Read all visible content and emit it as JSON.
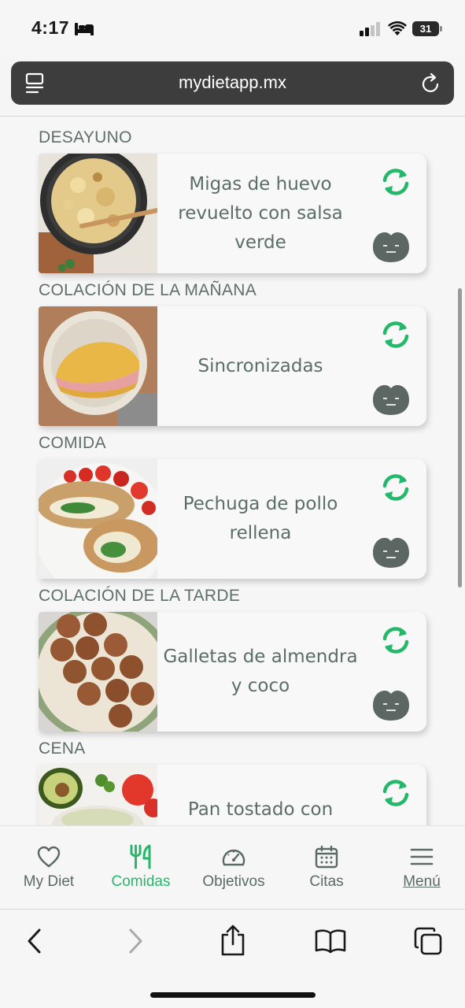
{
  "status": {
    "time": "4:17",
    "battery": "31"
  },
  "browser": {
    "url": "mydietapp.mx"
  },
  "meals": [
    {
      "label": "DESAYUNO",
      "title": "Migas de huevo revuelto con salsa verde"
    },
    {
      "label": "COLACIÓN DE LA MAÑANA",
      "title": "Sincronizadas"
    },
    {
      "label": "COMIDA",
      "title": "Pechuga de pollo rellena"
    },
    {
      "label": "COLACIÓN DE LA TARDE",
      "title": "Galletas de almendra y coco"
    },
    {
      "label": "CENA",
      "title": "Pan tostado con aguacate y queso"
    }
  ],
  "tabs": [
    {
      "label": "My Diet",
      "icon": "heart-icon"
    },
    {
      "label": "Comidas",
      "icon": "fork-knife-icon",
      "active": true
    },
    {
      "label": "Objetivos",
      "icon": "gauge-icon"
    },
    {
      "label": "Citas",
      "icon": "calendar-icon"
    },
    {
      "label": "Menú",
      "icon": "hamburger-menu-icon"
    }
  ],
  "colors": {
    "accent": "#25b86a",
    "text_muted": "#5a6e67",
    "url_bar": "#3d3d3d"
  }
}
